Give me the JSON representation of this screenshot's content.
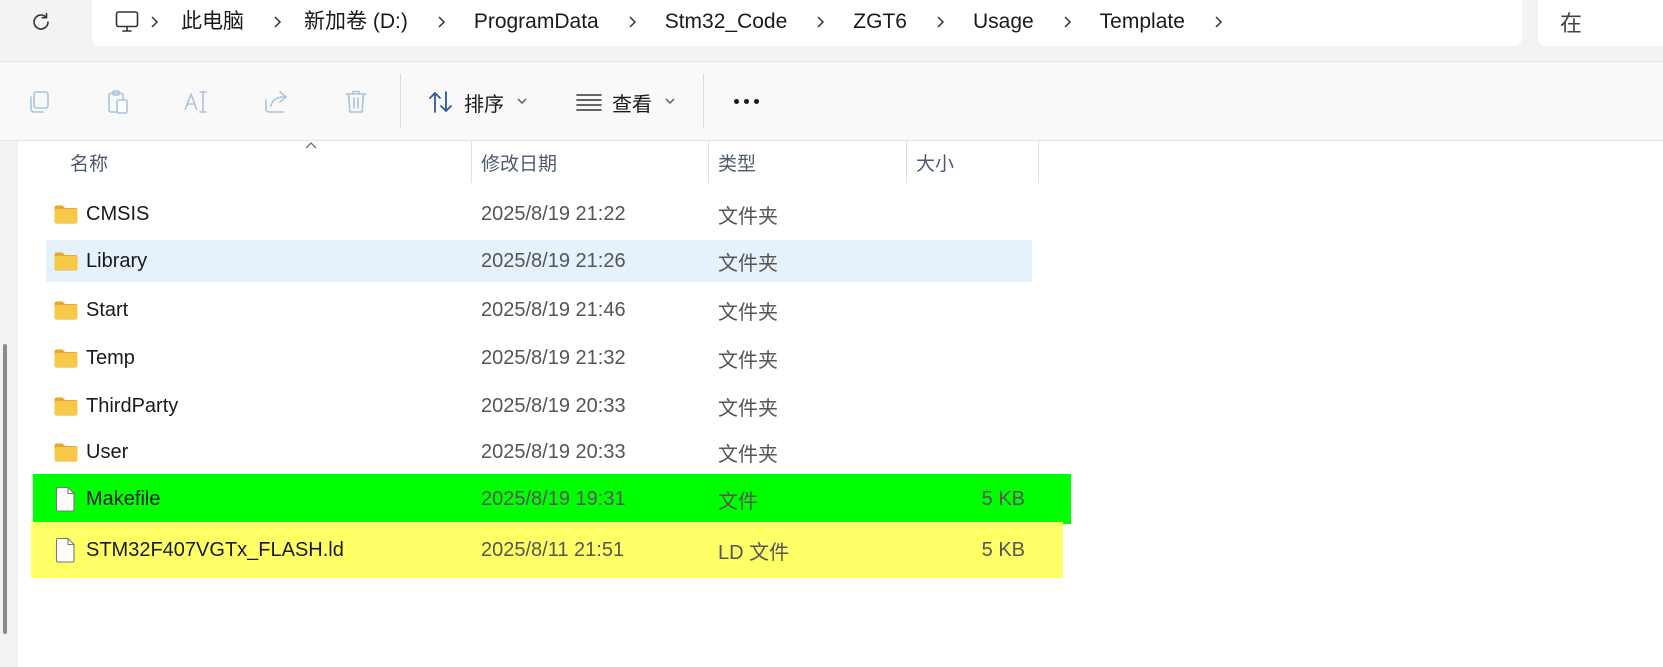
{
  "address": {
    "crumbs": [
      "此电脑",
      "新加卷 (D:)",
      "ProgramData",
      "Stm32_Code",
      "ZGT6",
      "Usage",
      "Template"
    ],
    "search_partial": "在"
  },
  "toolbar": {
    "sort_label": "排序",
    "view_label": "查看",
    "icons": [
      "copy-icon",
      "paste-icon",
      "rename-icon",
      "share-icon",
      "delete-icon"
    ]
  },
  "columns": {
    "name": "名称",
    "date": "修改日期",
    "type": "类型",
    "size": "大小"
  },
  "files": [
    {
      "name": "CMSIS",
      "date": "2025/8/19 21:22",
      "type": "文件夹",
      "size": "",
      "kind": "folder",
      "highlight": "none"
    },
    {
      "name": "Library",
      "date": "2025/8/19 21:26",
      "type": "文件夹",
      "size": "",
      "kind": "folder",
      "highlight": "selected"
    },
    {
      "name": "Start",
      "date": "2025/8/19 21:46",
      "type": "文件夹",
      "size": "",
      "kind": "folder",
      "highlight": "none"
    },
    {
      "name": "Temp",
      "date": "2025/8/19 21:32",
      "type": "文件夹",
      "size": "",
      "kind": "folder",
      "highlight": "none"
    },
    {
      "name": "ThirdParty",
      "date": "2025/8/19 20:33",
      "type": "文件夹",
      "size": "",
      "kind": "folder",
      "highlight": "none"
    },
    {
      "name": "User",
      "date": "2025/8/19 20:33",
      "type": "文件夹",
      "size": "",
      "kind": "folder",
      "highlight": "none"
    },
    {
      "name": "Makefile",
      "date": "2025/8/19 19:31",
      "type": "文件",
      "size": "5 KB",
      "kind": "file",
      "highlight": "green"
    },
    {
      "name": "STM32F407VGTx_FLASH.ld",
      "date": "2025/8/11 21:51",
      "type": "LD 文件",
      "size": "5 KB",
      "kind": "file",
      "highlight": "yellow"
    }
  ],
  "colors": {
    "selected_row": "#e5f1fb",
    "green_highlight": "#00ff00",
    "yellow_highlight": "#ffff66",
    "folder": "#f4c042"
  }
}
